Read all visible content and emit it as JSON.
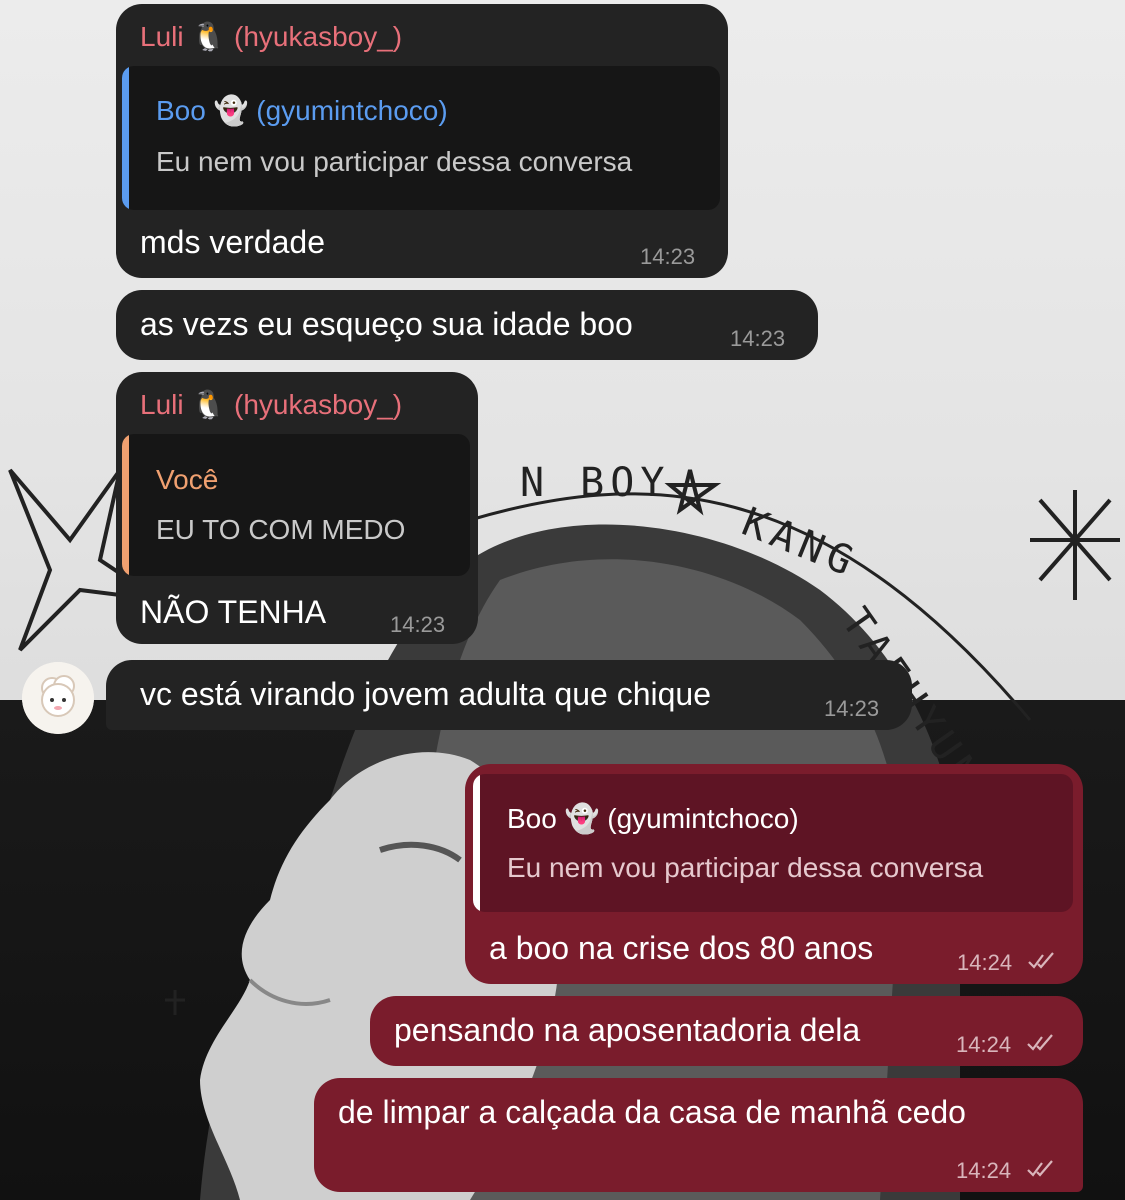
{
  "wallpaper": {
    "sketch_text_1": "N BOY",
    "sketch_text_2": "KANG",
    "sketch_text_3": "TAEHYUN"
  },
  "messages": [
    {
      "sender_name": "Luli",
      "sender_emoji": "🐧",
      "sender_handle": "(hyukasboy_)",
      "quote_name": "Boo",
      "quote_emoji": "👻",
      "quote_handle": "(gyumintchoco)",
      "quote_text": "Eu nem vou participar dessa conversa",
      "text": "mds verdade",
      "time": "14:23"
    },
    {
      "text": "as vezs eu esqueço sua idade boo",
      "time": "14:23"
    },
    {
      "sender_name": "Luli",
      "sender_emoji": "🐧",
      "sender_handle": "(hyukasboy_)",
      "quote_name": "Você",
      "quote_text": "EU TO COM MEDO",
      "text": "NÃO TENHA",
      "time": "14:23"
    },
    {
      "text": "vc está virando jovem adulta que chique",
      "time": "14:23"
    },
    {
      "quote_name": "Boo",
      "quote_emoji": "👻",
      "quote_handle": "(gyumintchoco)",
      "quote_text": "Eu nem vou participar dessa conversa",
      "text": "a boo na crise dos 80 anos",
      "time": "14:24"
    },
    {
      "text": "pensando na aposentadoria dela",
      "time": "14:24"
    },
    {
      "text": "de limpar a calçada da casa de manhã cedo",
      "time": "14:24"
    }
  ],
  "colors": {
    "incoming_bubble": "#232323",
    "outgoing_bubble": "#7a1c2c",
    "sender_name": "#e8707a",
    "quote_blue": "#5b9cf0",
    "quote_orange": "#f0a070",
    "quote_white": "#ffffff"
  },
  "icons": [
    "double-check-icon",
    "avatar"
  ]
}
